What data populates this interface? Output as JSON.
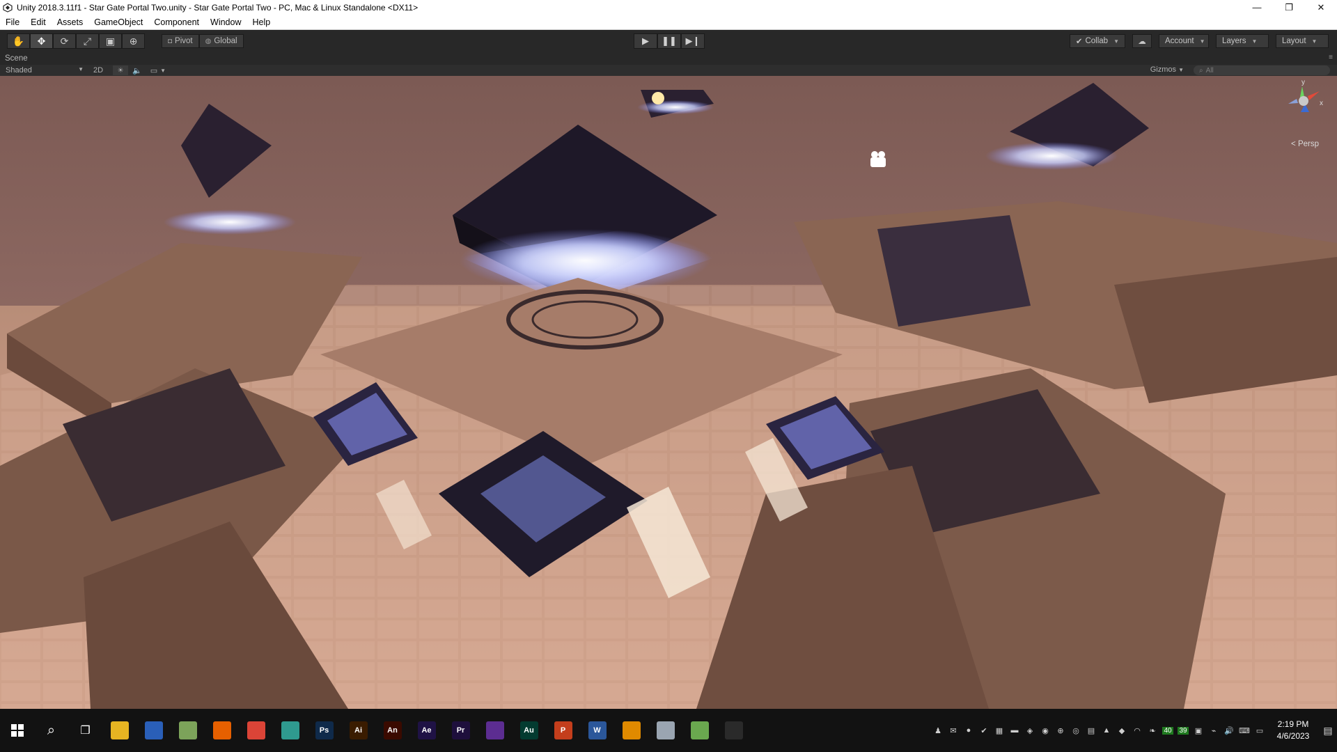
{
  "window": {
    "title": "Unity 2018.3.11f1 - Star Gate Portal Two.unity - Star Gate Portal Two - PC, Mac & Linux Standalone <DX11>",
    "controls": [
      "—",
      "❐",
      "✕"
    ]
  },
  "menu": [
    "File",
    "Edit",
    "Assets",
    "GameObject",
    "Component",
    "Window",
    "Help"
  ],
  "toolbar": {
    "tools": [
      "hand-tool",
      "move-tool",
      "rotate-tool",
      "scale-tool",
      "rect-tool",
      "transform-tool"
    ],
    "pivot_label": "Pivot",
    "global_label": "Global",
    "collab_label": "Collab",
    "account_label": "Account",
    "layers_label": "Layers",
    "layout_label": "Layout"
  },
  "scene": {
    "tab_label": "Scene",
    "shading_mode": "Shaded",
    "mode_2d": "2D",
    "gizmos_label": "Gizmos",
    "search_placeholder": "All",
    "persp_label": "Persp",
    "gizmo_axes": [
      "y",
      "x"
    ]
  },
  "taskbar": {
    "apps": [
      {
        "name": "file-explorer",
        "glyph": "",
        "color": "#e6b422"
      },
      {
        "name": "store",
        "glyph": "",
        "color": "#2a5fb8"
      },
      {
        "name": "app-3",
        "glyph": "",
        "color": "#7ca35a"
      },
      {
        "name": "firefox",
        "glyph": "",
        "color": "#e66000"
      },
      {
        "name": "chrome",
        "glyph": "",
        "color": "#db4437"
      },
      {
        "name": "app-6",
        "glyph": "",
        "color": "#2f9a8f"
      },
      {
        "name": "photoshop",
        "glyph": "Ps",
        "color": "#0f2a4a"
      },
      {
        "name": "illustrator",
        "glyph": "Ai",
        "color": "#3a1c00"
      },
      {
        "name": "animate",
        "glyph": "An",
        "color": "#3a0a00"
      },
      {
        "name": "after-effects",
        "glyph": "Ae",
        "color": "#1f1245"
      },
      {
        "name": "premiere",
        "glyph": "Pr",
        "color": "#1e0f3c"
      },
      {
        "name": "visual-studio",
        "glyph": "",
        "color": "#5c2d91"
      },
      {
        "name": "audition",
        "glyph": "Au",
        "color": "#033b30"
      },
      {
        "name": "powerpoint",
        "glyph": "P",
        "color": "#c43e1c"
      },
      {
        "name": "word",
        "glyph": "W",
        "color": "#2b579a"
      },
      {
        "name": "sublime",
        "glyph": "",
        "color": "#e08a00"
      },
      {
        "name": "app-17",
        "glyph": "",
        "color": "#9aa5b1"
      },
      {
        "name": "app-18",
        "glyph": "",
        "color": "#6aa84f"
      },
      {
        "name": "unity",
        "glyph": "",
        "color": "#2a2a2a"
      }
    ],
    "tray_numbers": [
      "40",
      "39"
    ],
    "time": "2:19 PM",
    "date": "4/6/2023"
  },
  "colors": {
    "sky": "#8f6a63",
    "floor": "#c6977d",
    "glow": "#cfd5ff",
    "dark_stone": "#2a2030"
  }
}
